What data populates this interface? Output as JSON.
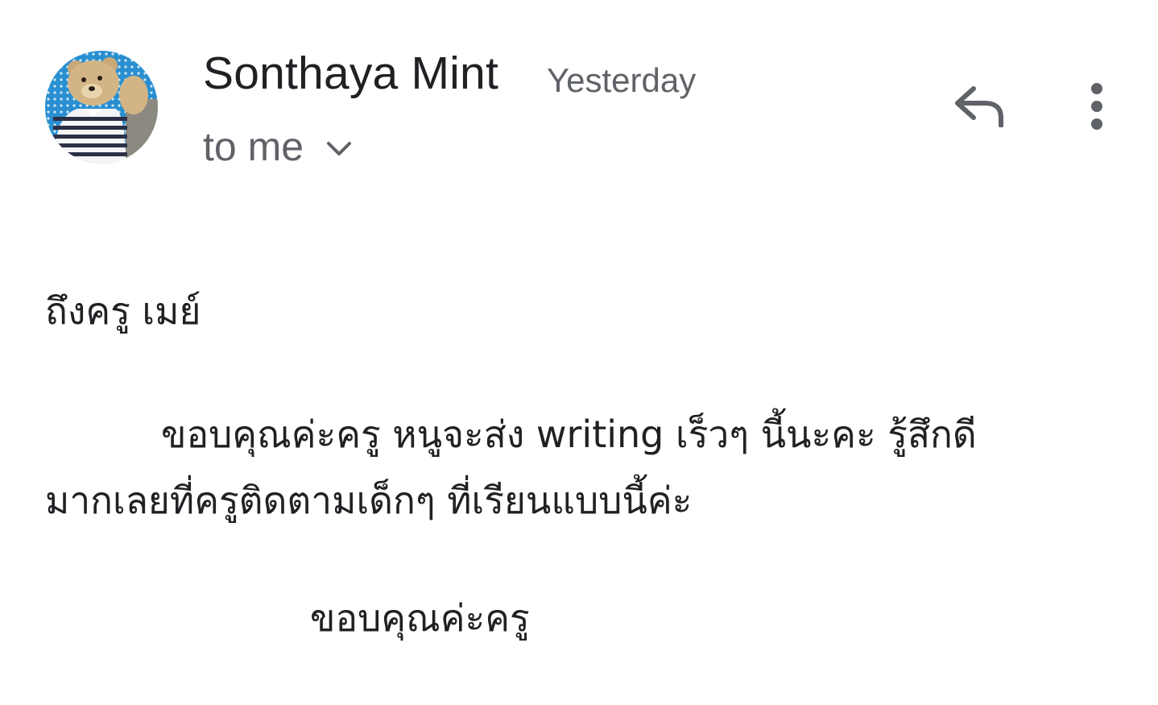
{
  "message": {
    "sender_name": "Sonthaya Mint",
    "timestamp": "Yesterday",
    "recipient_label": "to me",
    "avatar_icon": "teddy-bear-avatar",
    "actions": {
      "reply_icon": "reply-icon",
      "more_icon": "more-vert-icon"
    }
  },
  "body": {
    "greeting": "ถึงครู เมย์",
    "paragraph_line1": "ขอบคุณค่ะครู หนูจะส่ง writing เร็วๆ นี้นะคะ รู้สึกดี",
    "paragraph_line2": "มากเลยที่ครูติดตามเด็กๆ ที่เรียนแบบนี้ค่ะ",
    "closing": "ขอบคุณค่ะครู"
  },
  "colors": {
    "primary_text": "#202124",
    "secondary_text": "#5f6368",
    "icon": "#5f6368"
  }
}
